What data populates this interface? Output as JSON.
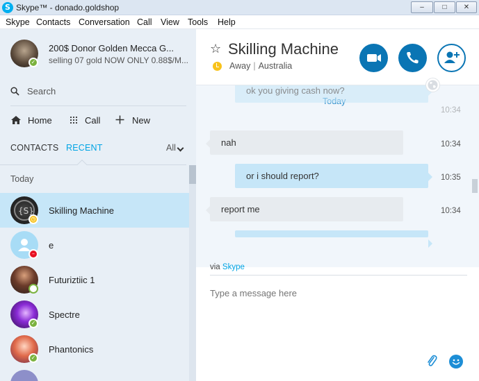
{
  "window": {
    "title": "Skype™ - donado.goldshop",
    "logo_letter": "S",
    "minimize": "–",
    "maximize": "□",
    "close": "✕"
  },
  "menu": [
    "Skype",
    "Contacts",
    "Conversation",
    "Call",
    "View",
    "Tools",
    "Help"
  ],
  "profile": {
    "name": "200$ Donor Golden Mecca  G...",
    "mood": "selling 07 gold NOW ONLY 0.88$/M...",
    "status": "online"
  },
  "search": {
    "label": "Search",
    "icon": "search-icon"
  },
  "nav": {
    "home": "Home",
    "call": "Call",
    "new": "New"
  },
  "tabs": {
    "contacts": "CONTACTS",
    "recent": "RECENT",
    "active": "RECENT",
    "filter": "All"
  },
  "recent": {
    "section_label": "Today",
    "contacts": [
      {
        "name": "Skilling Machine",
        "status": "away",
        "selected": true
      },
      {
        "name": "e",
        "status": "dnd",
        "selected": false
      },
      {
        "name": "Futuriztiic 1",
        "status": "offline",
        "selected": false
      },
      {
        "name": "Spectre",
        "status": "online",
        "selected": false
      },
      {
        "name": "Phantonics",
        "status": "online",
        "selected": false
      }
    ]
  },
  "chat": {
    "title": "Skilling Machine",
    "status": "Away",
    "location": "Australia",
    "day_label": "Today",
    "messages": [
      {
        "direction": "out",
        "text": "ok you giving cash now?",
        "time": "10:34"
      },
      {
        "direction": "in",
        "text": "nah",
        "time": "10:34"
      },
      {
        "direction": "out",
        "text": "or i should report?",
        "time": "10:35"
      },
      {
        "direction": "in",
        "text": "report me",
        "time": "10:34"
      },
      {
        "direction": "out",
        "text": "",
        "time": ""
      }
    ],
    "via_prefix": "via",
    "via_link": "Skype",
    "input_placeholder": "Type a message here"
  },
  "colors": {
    "accent": "#00a4e4",
    "button_blue": "#0a75b4",
    "selected_row": "#c6e6f8",
    "status_online": "#7bb23f",
    "status_away": "#f8c21b",
    "status_dnd": "#e81123"
  }
}
